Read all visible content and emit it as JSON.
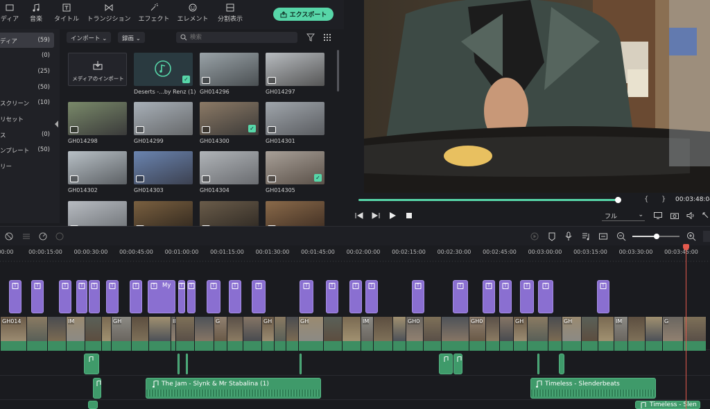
{
  "toolbar": {
    "tabs": [
      {
        "label": "ディア",
        "icon": "media-icon"
      },
      {
        "label": "音楽",
        "icon": "music-icon"
      },
      {
        "label": "タイトル",
        "icon": "title-icon"
      },
      {
        "label": "トランジション",
        "icon": "transition-icon"
      },
      {
        "label": "エフェクト",
        "icon": "effect-icon"
      },
      {
        "label": "エレメント",
        "icon": "element-icon"
      },
      {
        "label": "分割表示",
        "icon": "split-icon"
      }
    ],
    "export_label": "エクスポート"
  },
  "sidebar": {
    "items": [
      {
        "label": "ディア",
        "count": "(59)",
        "active": true
      },
      {
        "label": "",
        "count": "(0)"
      },
      {
        "label": "",
        "count": "(25)"
      },
      {
        "label": "",
        "count": "(50)"
      },
      {
        "label": "スクリーン",
        "count": "(10)"
      },
      {
        "label": "リセット",
        "count": ""
      },
      {
        "label": "ス",
        "count": "(0)"
      },
      {
        "label": "ンプレート",
        "count": "(50)"
      },
      {
        "label": "リー",
        "count": ""
      }
    ]
  },
  "media": {
    "import_dropdown": "インポート",
    "record_dropdown": "録画",
    "search_placeholder": "検索",
    "import_tile_label": "メディアのインポート",
    "tiles": [
      {
        "name": "Deserts -...by Renz (1)",
        "kind": "audio",
        "checked": true
      },
      {
        "name": "GH014296",
        "kind": "video",
        "colors": [
          "#9aa3a8",
          "#4a4f52"
        ]
      },
      {
        "name": "GH014297",
        "kind": "video",
        "colors": [
          "#b8bcc0",
          "#555"
        ]
      },
      {
        "name": "GH014298",
        "kind": "video",
        "colors": [
          "#7a8a6a",
          "#3a3a3a"
        ]
      },
      {
        "name": "GH014299",
        "kind": "video",
        "colors": [
          "#a8b0b8",
          "#66686a"
        ]
      },
      {
        "name": "GH014300",
        "kind": "video",
        "colors": [
          "#8c7a66",
          "#3c3a38"
        ],
        "checked": true
      },
      {
        "name": "GH014301",
        "kind": "video",
        "colors": [
          "#a0a6ac",
          "#5a5c60"
        ]
      },
      {
        "name": "GH014302",
        "kind": "video",
        "colors": [
          "#b8c0c6",
          "#5c6064"
        ]
      },
      {
        "name": "GH014303",
        "kind": "video",
        "colors": [
          "#6a84b0",
          "#3c4150"
        ]
      },
      {
        "name": "GH014304",
        "kind": "video",
        "colors": [
          "#b0b4b8",
          "#6a6c70"
        ]
      },
      {
        "name": "GH014305",
        "kind": "video",
        "colors": [
          "#a8a098",
          "#5a5048"
        ],
        "checked": true
      },
      {
        "name": "",
        "kind": "video",
        "colors": [
          "#b8bcc2",
          "#6a6e72"
        ]
      },
      {
        "name": "",
        "kind": "video",
        "colors": [
          "#7a6040",
          "#2c241c"
        ]
      },
      {
        "name": "",
        "kind": "video",
        "colors": [
          "#6a5c4a",
          "#2a2520"
        ]
      },
      {
        "name": "",
        "kind": "video",
        "colors": [
          "#8a6a4a",
          "#3a2a20"
        ]
      }
    ]
  },
  "player": {
    "progress": 0.99,
    "timecode": "00:03:48:04",
    "zoom": "フル",
    "brace_open": "{",
    "brace_close": "}"
  },
  "timeline": {
    "ruler": [
      "00:00",
      "00:00:15:00",
      "00:00:30:00",
      "00:00:45:00",
      "00:01:00:00",
      "00:01:15:00",
      "00:01:30:00",
      "00:01:45:00",
      "00:02:00:00",
      "00:02:15:00",
      "00:02:30:00",
      "00:02:45:00",
      "00:03:00:00",
      "00:03:15:00",
      "00:03:30:00",
      "00:03:45:00"
    ],
    "title_clip_text": "My",
    "video_labels": [
      "GH014",
      "IM",
      "GH",
      "IMG",
      "G",
      "GH",
      "GH",
      "IM",
      "GH0",
      "GH0",
      "GH",
      "GH",
      "IM",
      "G",
      "GH"
    ],
    "audio_tracks": [
      {
        "label": "The Jam - Slynk & Mr Stabalina (1)"
      },
      {
        "label": "Timeless - Slenderbeats"
      },
      {
        "label": "Timeless - Slen"
      }
    ]
  }
}
